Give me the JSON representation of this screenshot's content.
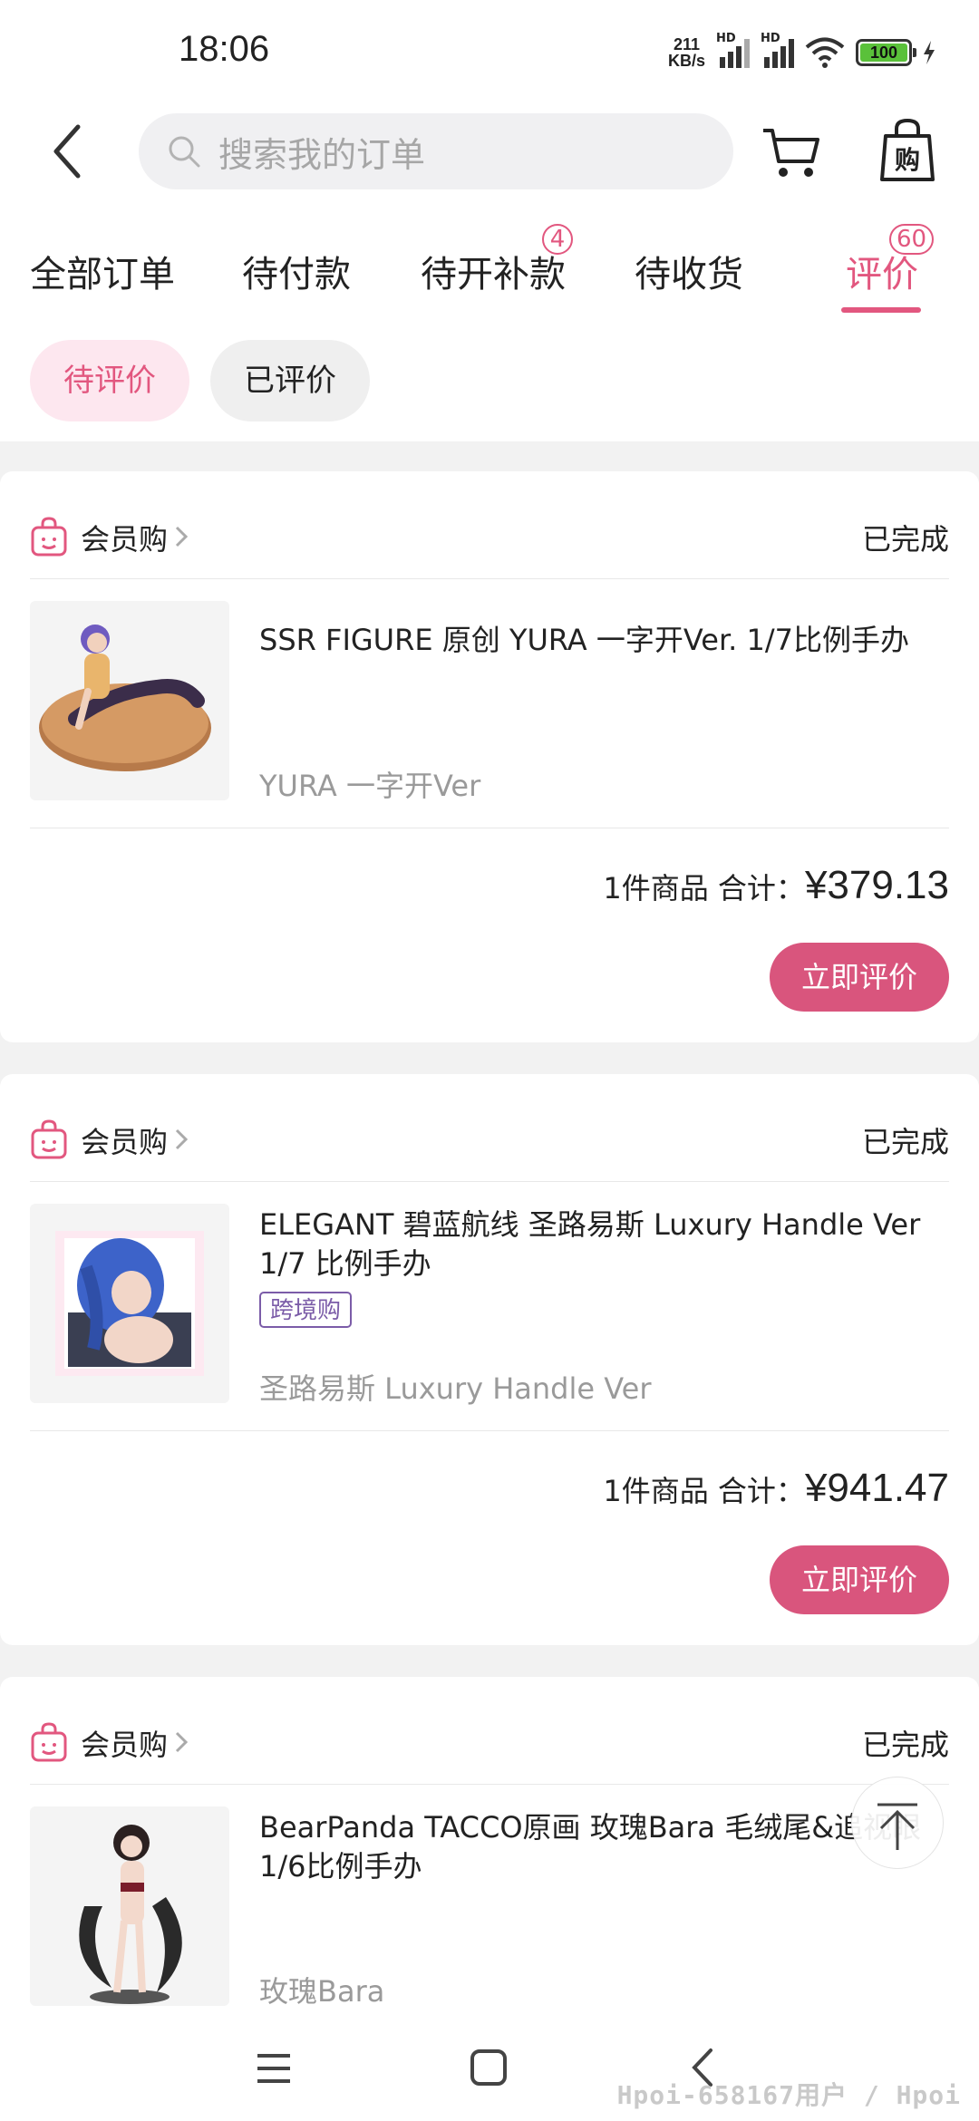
{
  "status_bar": {
    "time": "18:06",
    "net_speed_top": "211",
    "net_speed_unit": "KB/s",
    "battery": "100"
  },
  "header": {
    "search_placeholder": "搜索我的订单"
  },
  "tabs": [
    {
      "label": "全部订单",
      "badge": null
    },
    {
      "label": "待付款",
      "badge": null
    },
    {
      "label": "待开补款",
      "badge": "4"
    },
    {
      "label": "待收货",
      "badge": null
    },
    {
      "label": "评价",
      "badge": "60",
      "active": true
    }
  ],
  "sub_filters": {
    "pending": "待评价",
    "done": "已评价"
  },
  "orders": [
    {
      "shop": "会员购",
      "status": "已完成",
      "title": "SSR FIGURE 原创 YURA 一字开Ver. 1/7比例手办",
      "variant": "YURA 一字开Ver",
      "summary": "1件商品 合计：",
      "price": "¥379.13",
      "action": "立即评价"
    },
    {
      "shop": "会员购",
      "status": "已完成",
      "title": "ELEGANT 碧蓝航线 圣路易斯 Luxury Handle Ver 1/7 比例手办",
      "tag": "跨境购",
      "variant": "圣路易斯 Luxury Handle Ver",
      "summary": "1件商品 合计：",
      "price": "¥941.47",
      "action": "立即评价"
    },
    {
      "shop": "会员购",
      "status": "已完成",
      "title": "BearPanda TACCO原画 玫瑰Bara 毛绒尾&追视眼 1/6比例手办",
      "variant": "玫瑰Bara"
    }
  ],
  "watermark": "Hpoi-658167用户 / Hpoi",
  "colors": {
    "accent": "#e2577f",
    "button": "#d9557d",
    "tag": "#7b5ca8",
    "battery": "#5ac13a"
  }
}
